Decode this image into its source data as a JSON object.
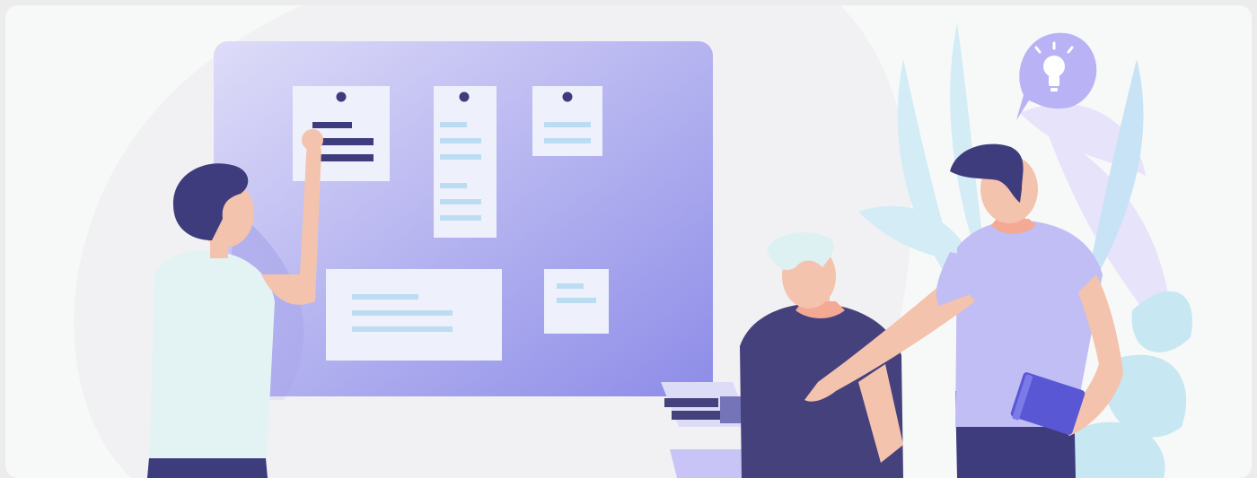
{
  "illustration": {
    "scene": "team-planning-board",
    "colors": {
      "frame_bg": "#f7f9f8",
      "outer_bg": "#ececec",
      "backdrop_blob": "#f1f1f3",
      "board_light": "#dcdcf7",
      "board_dark": "#8f8ee8",
      "note_paper": "#eef1fb",
      "note_line_blue": "#bcdcf2",
      "note_line_dark": "#3e3c7d",
      "pin": "#3e3c7d",
      "skin": "#f4c3ad",
      "hair_dark": "#3e3c7d",
      "hair_light": "#ddf0f2",
      "shirt_light": "#e3f3f4",
      "shirt_dark": "#45417d",
      "shirt_lavender": "#c1bdf5",
      "pants": "#3e3c7d",
      "laptop": "#c9c4f6",
      "tablet": "#5a57d4",
      "bulb_bubble": "#b9b3f6",
      "leaf_blue": "#c7e7f2",
      "leaf_lavender": "#e6e3fb"
    },
    "icons": [
      "lightbulb-icon",
      "pushpin-icon"
    ]
  }
}
